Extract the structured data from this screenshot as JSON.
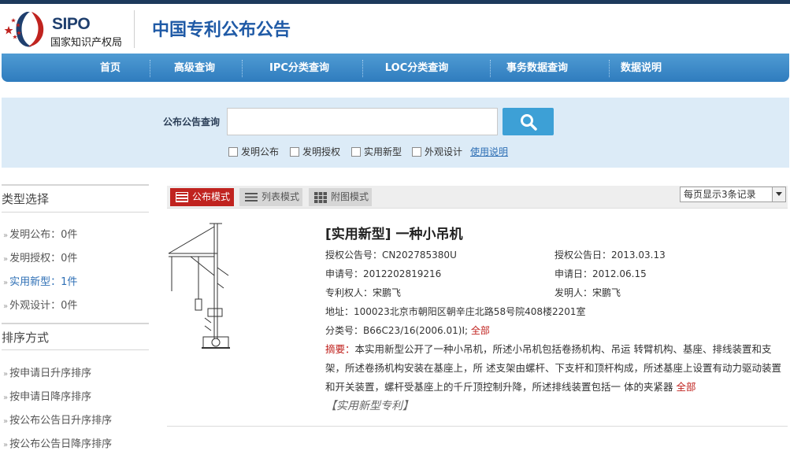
{
  "header": {
    "logo_en": "SIPO",
    "logo_cn": "国家知识产权局",
    "site_title": "中国专利公布公告"
  },
  "nav": {
    "items": [
      "首页",
      "高级查询",
      "IPC分类查询",
      "LOC分类查询",
      "事务数据查询",
      "数据说明"
    ]
  },
  "search": {
    "label": "公布公告查询",
    "input_value": "",
    "placeholder": "",
    "checkboxes": [
      "发明公布",
      "发明授权",
      "实用新型",
      "外观设计"
    ],
    "help_link": "使用说明"
  },
  "sidebar": {
    "type_title": "类型选择",
    "type_items": [
      {
        "label": "发明公布：0件",
        "active": false
      },
      {
        "label": "发明授权：0件",
        "active": false
      },
      {
        "label": "实用新型：1件",
        "active": true
      },
      {
        "label": "外观设计：0件",
        "active": false
      }
    ],
    "sort_title": "排序方式",
    "sort_items": [
      "按申请日升序排序",
      "按申请日降序排序",
      "按公布公告日升序排序",
      "按公布公告日降序排序"
    ]
  },
  "toolbar": {
    "modes": [
      "公布模式",
      "列表模式",
      "附图模式"
    ],
    "per_page": "每页显示3条记录"
  },
  "result": {
    "title": "[实用新型] 一种小吊机",
    "grant_no": "授权公告号：CN202785380U",
    "grant_date": "授权公告日：2013.03.13",
    "app_no": "申请号：2012202819216",
    "app_date": "申请日：2012.06.15",
    "patentee": "专利权人：宋鹏飞",
    "inventor": "发明人：宋鹏飞",
    "address": "地址：100023北京市朝阳区朝辛庄北路58号院408楼2201室",
    "classification": "分类号：B66C23/16(2006.01)I;",
    "classification_all": "全部",
    "abstract_label": "摘要：",
    "abstract_text": "本实用新型公开了一种小吊机，所述小吊机包括卷扬机构、吊运 转臂机构、基座、排线装置和支架，所述卷扬机构安装在基座上，所 述支架由螺杆、下支杆和顶杆构成，所述基座上设置有动力驱动装置 和开关装置，螺杆受基座上的千斤顶控制升降，所述排线装置包括一 体的夹紧器",
    "abstract_all": "全部",
    "tag": "【实用新型专利】"
  },
  "colors": {
    "nav_blue": "#2f7cbe",
    "accent_red": "#c0231f",
    "link_blue": "#2e6fb5",
    "search_bg": "#dcebf7"
  }
}
